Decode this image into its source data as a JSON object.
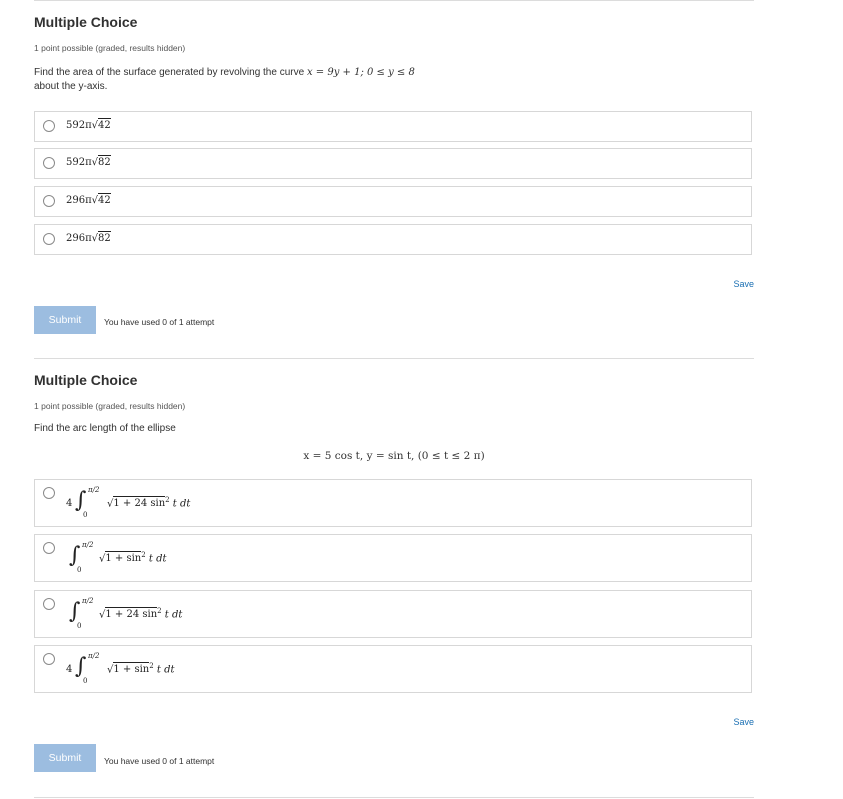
{
  "problems": [
    {
      "title": "Multiple Choice",
      "meta": "1 point possible (graded, results hidden)",
      "question_text_1": "Find the area of the surface generated by revolving the curve",
      "question_math": "x = 9y + 1; 0 ≤ y ≤ 8",
      "question_text_2": "about the y-axis.",
      "choices": [
        {
          "coef": "592π",
          "radicand": "42"
        },
        {
          "coef": "592π",
          "radicand": "82"
        },
        {
          "coef": "296π",
          "radicand": "42"
        },
        {
          "coef": "296π",
          "radicand": "82"
        }
      ],
      "save_label": "Save",
      "submit_label": "Submit",
      "attempts": "You have used 0 of 1 attempt"
    },
    {
      "title": "Multiple Choice",
      "meta": "1 point possible (graded, results hidden)",
      "question_text_1": "Find the arc length of the ellipse",
      "question_math": "x = 5 cos t, y = sin t,  (0 ≤ t ≤ 2 π)",
      "choices": [
        {
          "coef": "4",
          "upper": "π/2",
          "lower": "0",
          "integrand": "1 + 24 sin",
          "power": "2",
          "tail": " t dt"
        },
        {
          "coef": "",
          "upper": "π/2",
          "lower": "0",
          "integrand": "1 + sin",
          "power": "2",
          "tail": " t dt"
        },
        {
          "coef": "",
          "upper": "π/2",
          "lower": "0",
          "integrand": "1 + 24 sin",
          "power": "2",
          "tail": " t dt"
        },
        {
          "coef": "4",
          "upper": "π/2",
          "lower": "0",
          "integrand": "1 + sin",
          "power": "2",
          "tail": " t dt"
        }
      ],
      "save_label": "Save",
      "submit_label": "Submit",
      "attempts": "You have used 0 of 1 attempt"
    }
  ]
}
